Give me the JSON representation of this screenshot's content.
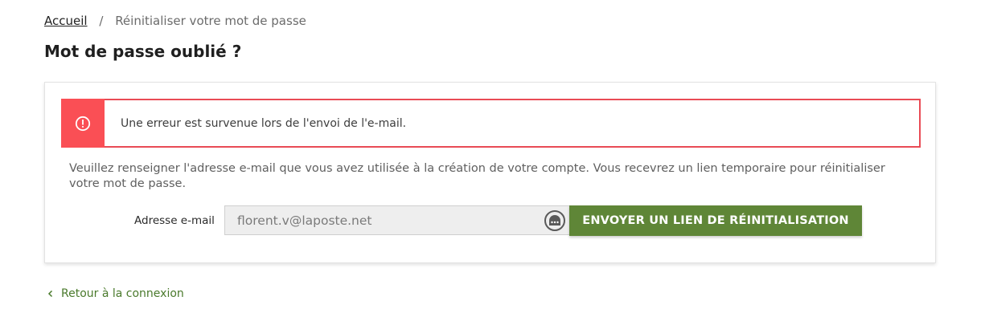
{
  "breadcrumb": {
    "home_label": "Accueil",
    "separator": "/",
    "current_label": "Réinitialiser votre mot de passe"
  },
  "page_title": "Mot de passe oublié ?",
  "alert": {
    "icon": "exclamation-circle-icon",
    "message": "Une erreur est survenue lors de l'envoi de l'e-mail.",
    "color": "#fa4f55"
  },
  "form": {
    "instructions": "Veuillez renseigner l'adresse e-mail que vous avez utilisée à la création de votre compte. Vous recevrez un lien temporaire pour réinitialiser votre mot de passe.",
    "email_label": "Adresse e-mail",
    "email_value": "florent.v@laposte.net",
    "password_manager_icon": "password-manager-icon",
    "submit_label": "ENVOYER UN LIEN DE RÉINITIALISATION",
    "submit_color": "#5f8637"
  },
  "back_link": {
    "icon": "chevron-left-icon",
    "label": "Retour à la connexion"
  }
}
